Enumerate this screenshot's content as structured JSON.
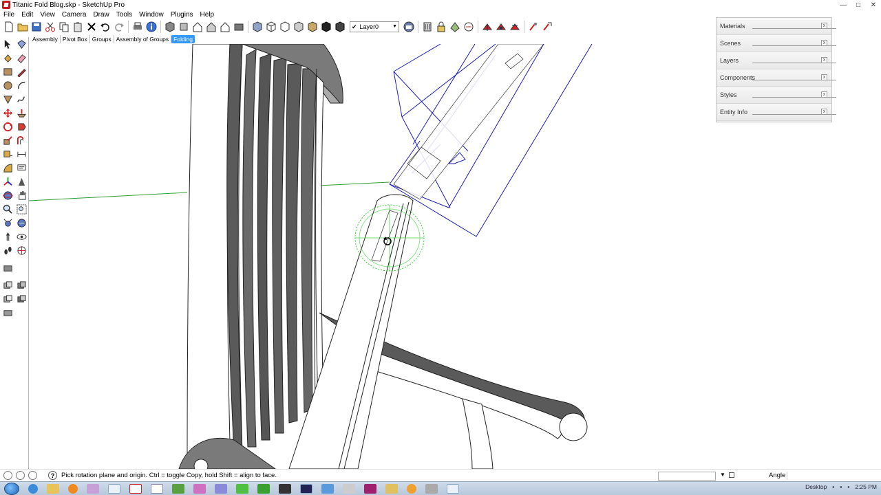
{
  "window": {
    "title": "Titanic Fold Blog.skp - SketchUp Pro",
    "minimize": "—",
    "maximize": "□",
    "close": "✕"
  },
  "menu": [
    "File",
    "Edit",
    "View",
    "Camera",
    "Draw",
    "Tools",
    "Window",
    "Plugins",
    "Help"
  ],
  "toolbar": {
    "layer_select": {
      "checked": "✔",
      "value": "Layer0",
      "arrow": "▼"
    }
  },
  "tabs": [
    {
      "label": "Assembly"
    },
    {
      "label": "Pivot Box"
    },
    {
      "label": "Groups"
    },
    {
      "label": "Assembly of Groups"
    },
    {
      "label": "Folding"
    }
  ],
  "active_tab": "Folding",
  "tray": [
    {
      "label": "Materials"
    },
    {
      "label": "Scenes"
    },
    {
      "label": "Layers"
    },
    {
      "label": "Components"
    },
    {
      "label": "Styles"
    },
    {
      "label": "Entity Info"
    }
  ],
  "status": {
    "help_glyph": "?",
    "message": "Pick rotation plane and origin.  Ctrl = toggle Copy, hold Shift = align to face.",
    "vcb_label": "Angle",
    "vcb_value": ""
  },
  "taskbar": {
    "desktop_label": "Desktop",
    "clock": "2:25 PM"
  },
  "colors": {
    "accent": "#3399ff",
    "selection_blue": "#1a1ab4",
    "protractor_green": "#33cc33",
    "axis_green": "#2e9e2e"
  }
}
